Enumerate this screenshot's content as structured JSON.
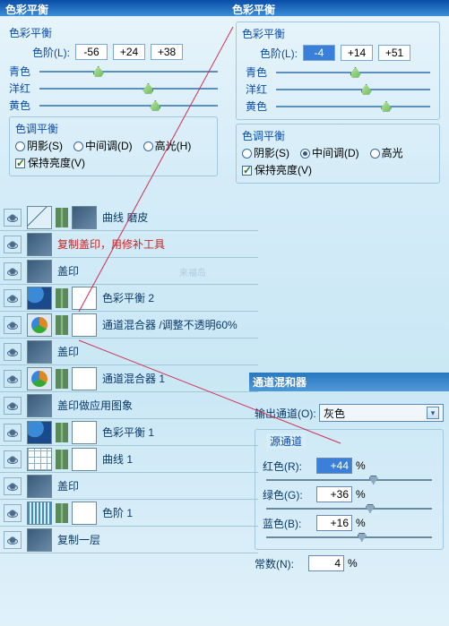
{
  "panel1": {
    "title": "色彩平衡",
    "sub": "色彩平衡",
    "levels_label": "色阶(L):",
    "l1": "-56",
    "l2": "+24",
    "l3": "+38",
    "cyan": "青色",
    "magenta": "洋红",
    "yellow": "黄色",
    "tone_title": "色调平衡",
    "shadows": "阴影(S)",
    "midtones": "中间调(D)",
    "highlights": "高光(H)",
    "preserve": "保持亮度(V)"
  },
  "panel2": {
    "title": "色彩平衡",
    "sub": "色彩平衡",
    "levels_label": "色阶(L):",
    "l1": "-4",
    "l2": "+14",
    "l3": "+51",
    "cyan": "青色",
    "magenta": "洋红",
    "yellow": "黄色",
    "tone_title": "色调平衡",
    "shadows": "阴影(S)",
    "midtones": "中间调(D)",
    "highlights": "高光",
    "preserve": "保持亮度(V)"
  },
  "layers": {
    "l0": "曲线 磨皮",
    "l1": "复制盖印，用修补工具",
    "l2": "盖印",
    "l3": "色彩平衡 2",
    "l4": "通道混合器 /调整不透明60%",
    "l5": "盖印",
    "l6": "通道混合器 1",
    "l7": "盖印做应用图象",
    "l8": "色彩平衡 1",
    "l9": "曲线 1",
    "l10": "盖印",
    "l11": "色阶 1",
    "l12": "复制一层"
  },
  "mixer": {
    "title": "通道混和器",
    "outch": "输出通道(O):",
    "gray": "灰色",
    "src": "源通道",
    "red": "红色(R):",
    "rv": "+44",
    "green": "绿色(G):",
    "gv": "+36",
    "blue": "蓝色(B):",
    "bv": "+16",
    "const": "常数(N):",
    "cv": "4",
    "pct": "%"
  },
  "watermark": "来福岛"
}
